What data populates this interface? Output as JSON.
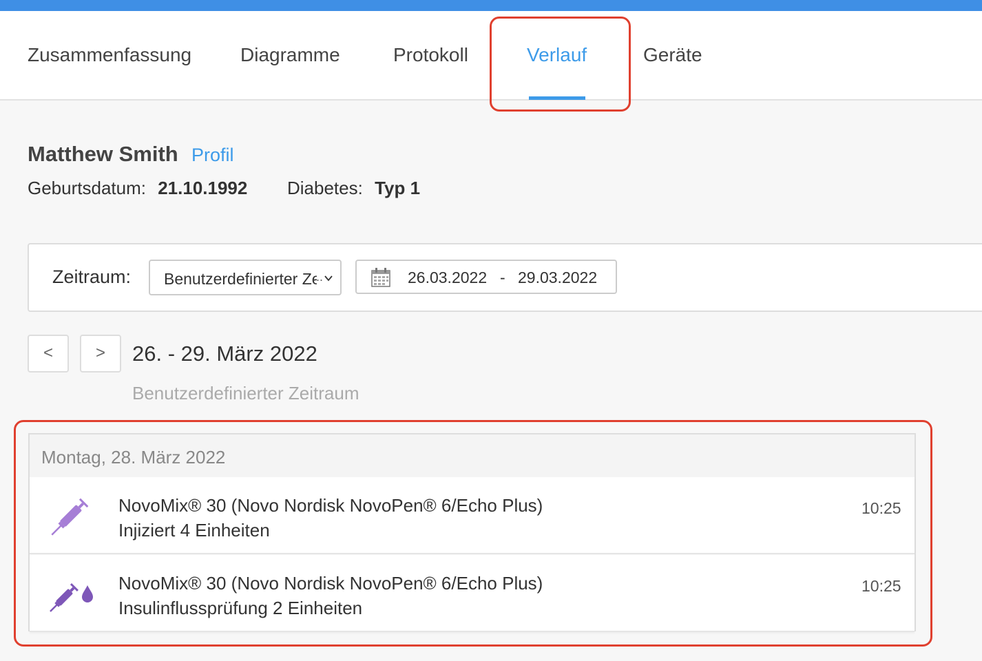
{
  "tabs": [
    {
      "label": "Zusammenfassung",
      "active": false
    },
    {
      "label": "Diagramme",
      "active": false
    },
    {
      "label": "Protokoll",
      "active": false
    },
    {
      "label": "Verlauf",
      "active": true
    },
    {
      "label": "Geräte",
      "active": false
    }
  ],
  "patient": {
    "name": "Matthew Smith",
    "profile_link": "Profil",
    "birthdate_label": "Geburtsdatum:",
    "birthdate": "21.10.1992",
    "diabetes_label": "Diabetes:",
    "diabetes_type": "Typ 1"
  },
  "filter": {
    "label": "Zeitraum:",
    "period_select": "Benutzerdefinierter Zeitraum",
    "ellipsis": "...",
    "date_from": "26.03.2022",
    "separator": "-",
    "date_to": "29.03.2022"
  },
  "range": {
    "prev_label": "<",
    "next_label": ">",
    "title": "26. - 29. März 2022",
    "subtitle": "Benutzerdefinierter Zeitraum"
  },
  "day": {
    "header": "Montag, 28. März 2022",
    "entries": [
      {
        "title": "NovoMix® 30 (Novo Nordisk NovoPen® 6/Echo Plus)",
        "detail": "Injiziert 4 Einheiten",
        "time": "10:25",
        "icon": "syringe-icon"
      },
      {
        "title": "NovoMix® 30 (Novo Nordisk NovoPen® 6/Echo Plus)",
        "detail": "Insulinflussprüfung 2 Einheiten",
        "time": "10:25",
        "icon": "syringe-drop-icon"
      }
    ]
  },
  "colors": {
    "accent": "#3d9be9",
    "topbar": "#3f8fe5",
    "highlight": "#e0402f",
    "syringe_light": "#a67ed6",
    "syringe_dark": "#7e57b8"
  }
}
